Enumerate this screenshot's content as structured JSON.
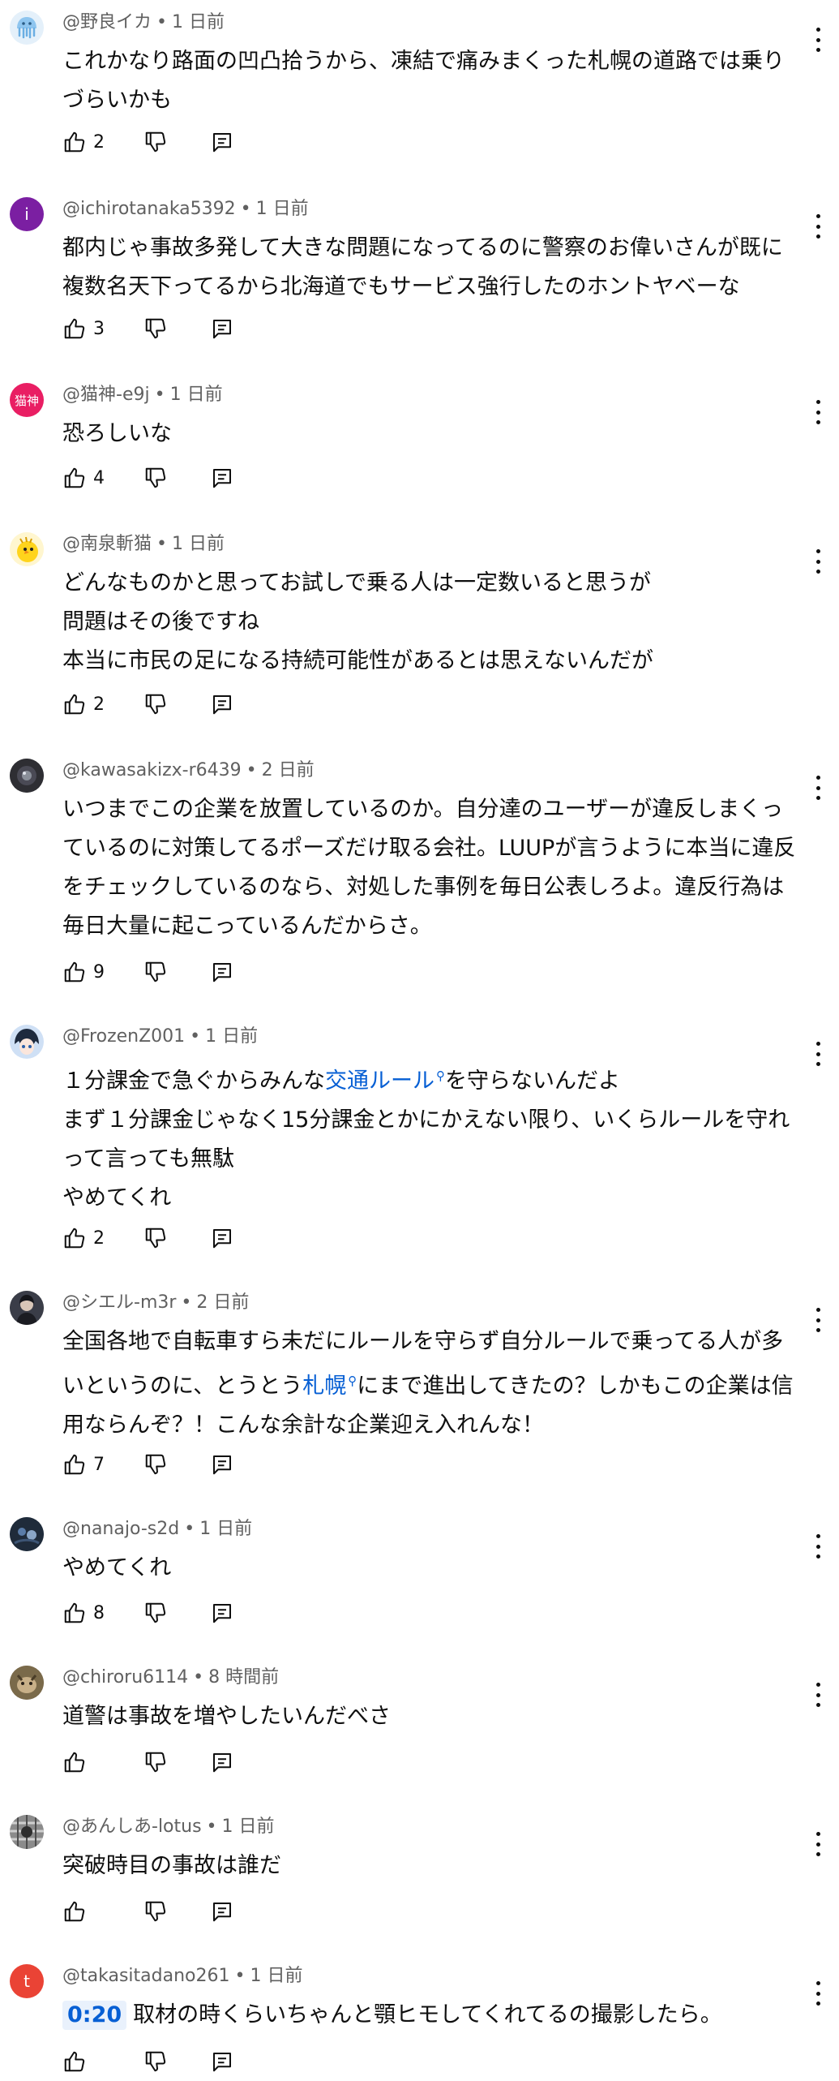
{
  "comments": [
    {
      "id": "c1",
      "author": "@野良イカ",
      "time": "1 日前",
      "avatar": "jellyfish-avatar",
      "avatar_text": "",
      "lines": [
        [
          {
            "t": "これかなり路面の凹凸拾うから、凍結で痛みまくった札幌の道路では乗り"
          }
        ],
        [
          {
            "t": "づらいかも"
          }
        ]
      ],
      "likes": "2"
    },
    {
      "id": "c2",
      "author": "@ichirotanaka5392",
      "time": "1 日前",
      "avatar": "letter-avatar",
      "avatar_text": "i",
      "lines": [
        [
          {
            "t": "都内じゃ事故多発して大きな問題になってるのに警察のお偉いさんが既に"
          }
        ],
        [
          {
            "t": "複数名天下ってるから北海道でもサービス強行したのホントヤベーな"
          }
        ]
      ],
      "likes": "3"
    },
    {
      "id": "c3",
      "author": "@猫神-e9j",
      "time": "1 日前",
      "avatar": "letter-avatar",
      "avatar_text": "猫神",
      "lines": [
        [
          {
            "t": "恐ろしいな"
          }
        ]
      ],
      "likes": "4"
    },
    {
      "id": "c4",
      "author": "@南泉斬猫",
      "time": "1 日前",
      "avatar": "chick-avatar",
      "avatar_text": "",
      "lines": [
        [
          {
            "t": "どんなものかと思ってお試しで乗る人は一定数いると思うが"
          }
        ],
        [
          {
            "t": "問題はその後ですね"
          }
        ],
        [
          {
            "t": "本当に市民の足になる持続可能性があるとは思えないんだが"
          }
        ]
      ],
      "likes": "2"
    },
    {
      "id": "c5",
      "author": "@kawasakizx-r6439",
      "time": "2 日前",
      "avatar": "photo-avatar",
      "avatar_text": "",
      "lines": [
        [
          {
            "t": "いつまでこの企業を放置しているのか。自分達のユーザーが違反しまくっ"
          }
        ],
        [
          {
            "t": "ているのに対策してるポーズだけ取る会社。LUUPが言うように本当に違反"
          }
        ],
        [
          {
            "t": "をチェックしているのなら、対処した事例を毎日公表しろよ。違反行為は"
          }
        ],
        [
          {
            "t": "毎日大量に起こっているんだからさ。"
          }
        ]
      ],
      "likes": "9"
    },
    {
      "id": "c6",
      "author": "@FrozenZ001",
      "time": "1 日前",
      "avatar": "anime-avatar",
      "avatar_text": "",
      "lines": [
        [
          {
            "t": "１分課金で急ぐからみんな"
          },
          {
            "t": "交通ルール",
            "link": true
          },
          {
            "t": "を守らないんだよ"
          }
        ],
        [
          {
            "t": "まず１分課金じゃなく15分課金とかにかえない限り、いくらルールを守れ"
          }
        ],
        [
          {
            "t": "って言っても無駄"
          }
        ],
        [
          {
            "t": "やめてくれ"
          }
        ]
      ],
      "likes": "2"
    },
    {
      "id": "c7",
      "author": "@シエル-m3r",
      "time": "2 日前",
      "avatar": "portrait-avatar",
      "avatar_text": "",
      "lines": [
        [
          {
            "t": "全国各地で自転車すら未だにルールを守らず自分ルールで乗ってる人が多"
          }
        ],
        [
          {
            "t": "いというのに、とうとう"
          },
          {
            "t": "札幌",
            "link": true
          },
          {
            "t": "にまで進出してきたの？しかもこの企業は信"
          }
        ],
        [
          {
            "t": "用ならんぞ？！こんな余計な企業迎え入れんな！"
          }
        ]
      ],
      "likes": "7"
    },
    {
      "id": "c8",
      "author": "@nanajo-s2d",
      "time": "1 日前",
      "avatar": "dark-avatar",
      "avatar_text": "",
      "lines": [
        [
          {
            "t": "やめてくれ"
          }
        ]
      ],
      "likes": "8"
    },
    {
      "id": "c9",
      "author": "@chiroru6114",
      "time": "8 時間前",
      "avatar": "animal-avatar",
      "avatar_text": "",
      "lines": [
        [
          {
            "t": "道警は事故を増やしたいんだべさ"
          }
        ]
      ],
      "likes": ""
    },
    {
      "id": "c10",
      "author": "@あんしあ-lotus",
      "time": "1 日前",
      "avatar": "pattern-avatar",
      "avatar_text": "",
      "lines": [
        [
          {
            "t": "突破時目の事故は誰だ"
          }
        ]
      ],
      "likes": ""
    },
    {
      "id": "c11",
      "author": "@takasitadano261",
      "time": "1 日前",
      "avatar": "letter-avatar",
      "avatar_text": "t",
      "lines": [
        [
          {
            "ts": "0:20"
          },
          {
            "t": "取材の時くらいちゃんと顎ヒモしてくれてるの撮影したら。"
          }
        ]
      ],
      "likes": ""
    }
  ]
}
